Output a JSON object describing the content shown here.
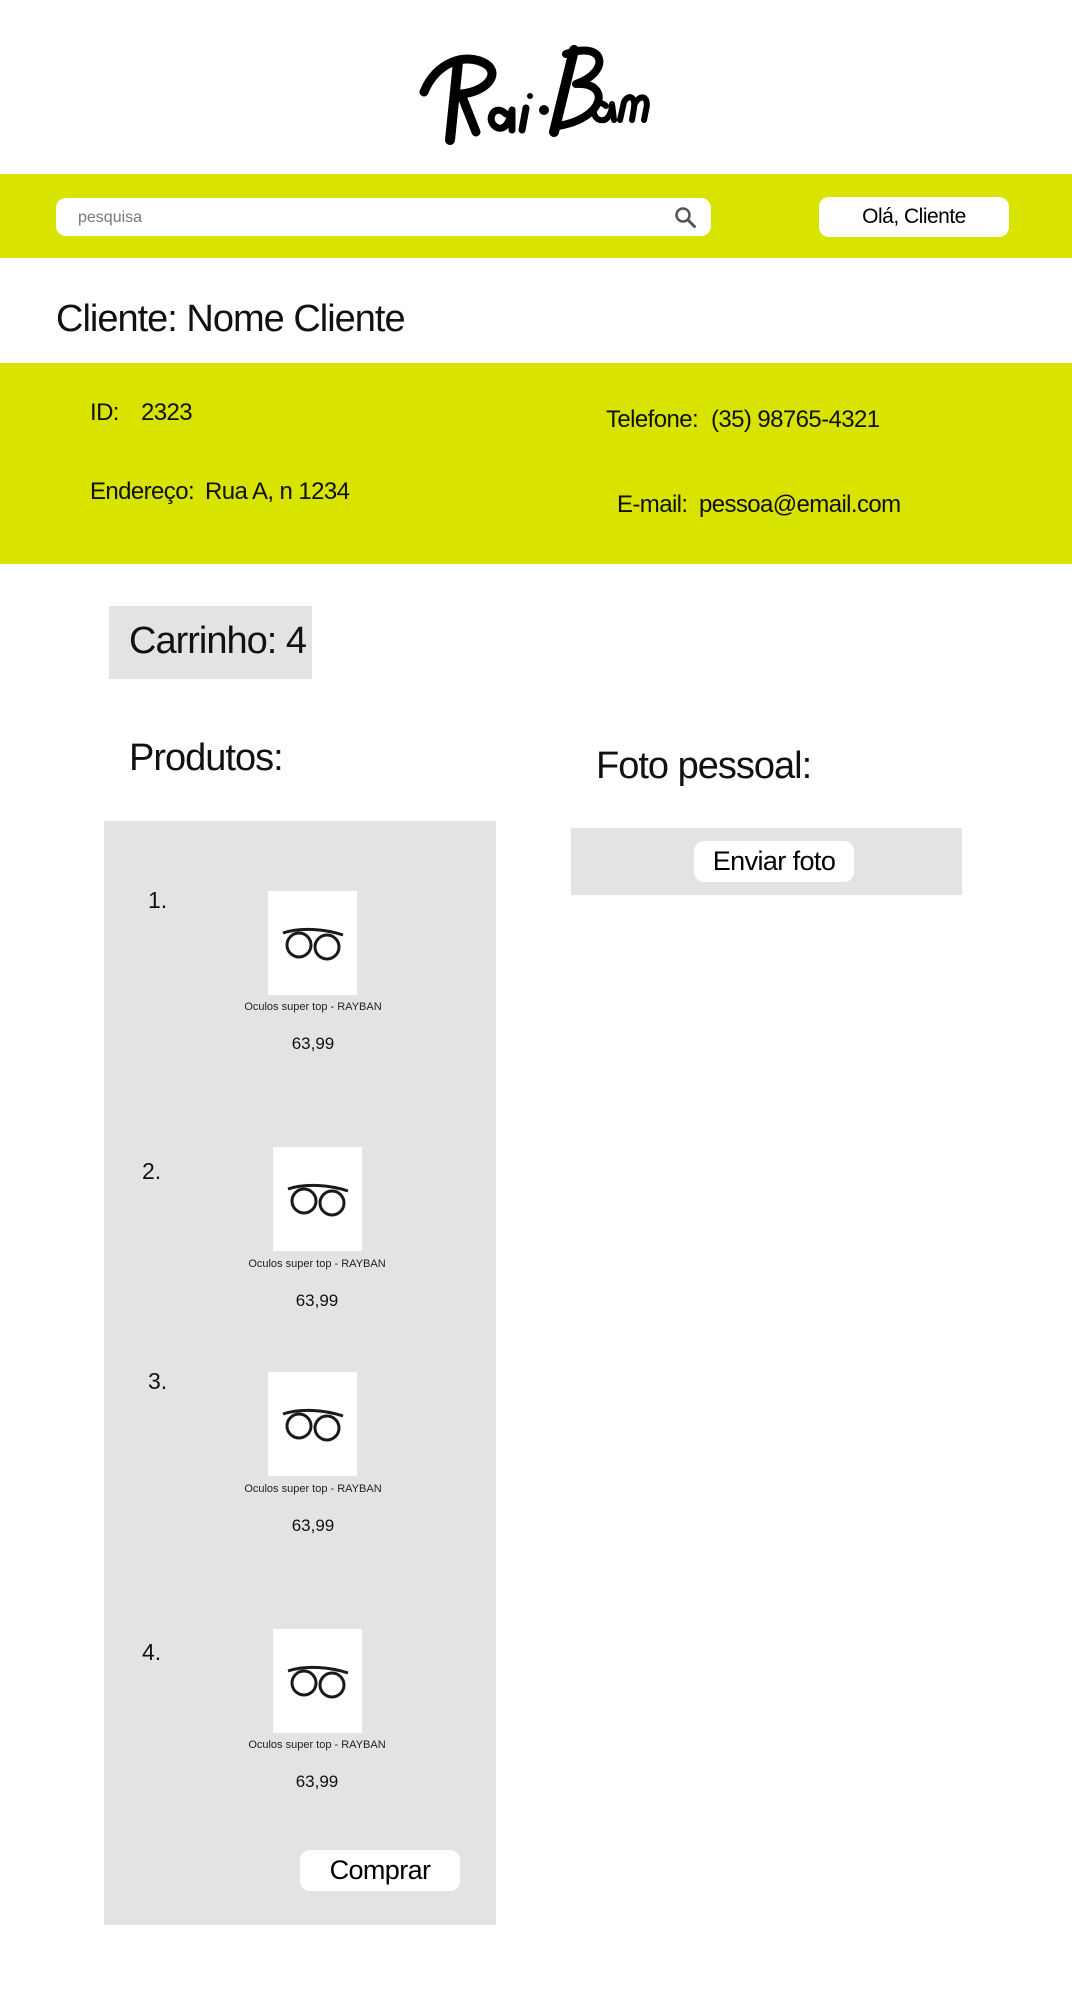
{
  "brand": {
    "logo_text": "Rai-Bam"
  },
  "header": {
    "search_placeholder": "pesquisa",
    "greeting_button": "Olá, Cliente"
  },
  "client": {
    "title": "Cliente: Nome Cliente",
    "id_label": "ID:",
    "id_value": "2323",
    "address_label": "Endereço:",
    "address_value": "Rua A, n 1234",
    "phone_label": "Telefone:",
    "phone_value": "(35) 98765-4321",
    "email_label": "E-mail:",
    "email_value": "pessoa@email.com"
  },
  "cart": {
    "label": "Carrinho: 4"
  },
  "products": {
    "title": "Produtos:",
    "items": [
      {
        "number": "1.",
        "name": "Oculos super top - RAYBAN",
        "price": "63,99"
      },
      {
        "number": "2.",
        "name": "Oculos super top - RAYBAN",
        "price": "63,99"
      },
      {
        "number": "3.",
        "name": "Oculos super top - RAYBAN",
        "price": "63,99"
      },
      {
        "number": "4.",
        "name": "Oculos super top - RAYBAN",
        "price": "63,99"
      }
    ],
    "buy_button": "Comprar"
  },
  "photo": {
    "title": "Foto pessoal:",
    "send_button": "Enviar foto"
  },
  "colors": {
    "accent": "#d8e300",
    "panel": "#e3e3e3"
  }
}
